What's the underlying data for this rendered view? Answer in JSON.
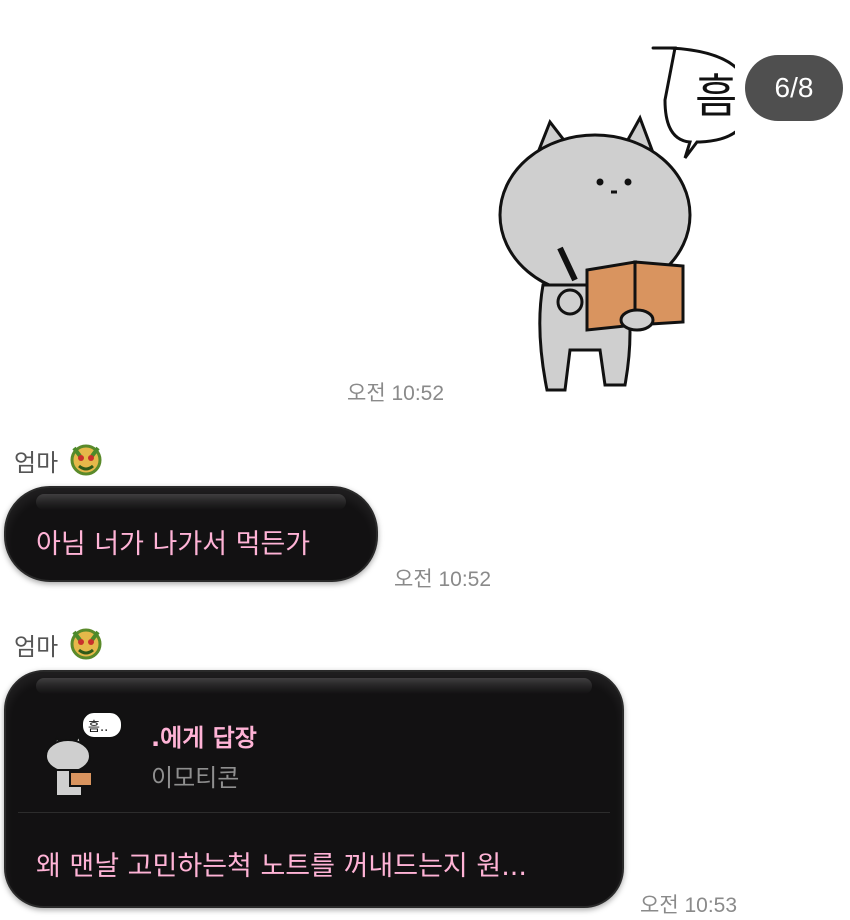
{
  "page_counter": "6/8",
  "sticker": {
    "speech": "흠",
    "icon": "cat-reading-note-sticker"
  },
  "messages": [
    {
      "time": "오전 10:52"
    },
    {
      "sender": "엄마",
      "text": "아님 너가 나가서 먹든가",
      "time": "오전 10:52"
    },
    {
      "sender": "엄마",
      "reply": {
        "to": ".에게 답장",
        "type": "이모티콘",
        "thumb_speech": "흠.."
      },
      "text": "왜 맨날 고민하는척 노트를 꺼내드는지 원...",
      "time": "오전 10:53"
    }
  ],
  "colors": {
    "bubble": "#121112",
    "text": "#ffb3d6",
    "time": "#8a8a8a"
  }
}
